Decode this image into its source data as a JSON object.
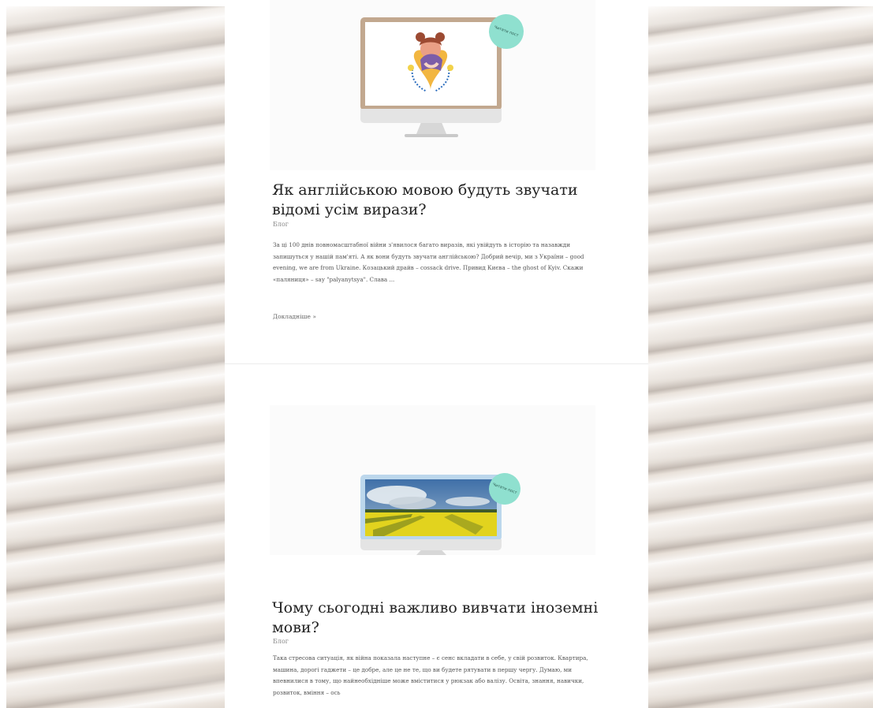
{
  "posts": [
    {
      "badge": "Читати пост",
      "title": "Як англійською мовою будуть звучати відомі усім вирази?",
      "category": "Блог",
      "excerpt": "За ці 100 днів повномасштабної війни з'явилося багато виразів, які увійдуть в історію та назавжди запишуться у нашій пам'яті. А як вони будуть звучати англійською? Добрий вечір, ми з України – good evening, we are from Ukraine. Козацький драйв – cossack drive. Привид Києва – the ghost of Kyiv. Скажи «паляниця» – say \"palyanytsya\". Слава ...",
      "read_more": "Докладніше »",
      "thumb_icon": "woman-hugging-heart-illustration"
    },
    {
      "badge": "Читати пост",
      "title": "Чому сьогодні важливо вивчати іноземні мови?",
      "category": "Блог",
      "excerpt": "Така стресова ситуація, як війна показала наступне – є сенс вкладати в себе, у свій розвиток. Квартира, машина, дорогі гаджети – це добре, але це не те, що ви будете рятувати в першу чергу. Думаю, ми впевнилися в тому, що найнеобхідніше може вміститися у рюкзак або валізу. Освіта, знання, навички, розвиток, вміння – ось",
      "thumb_icon": "sunflower-field-photo"
    }
  ],
  "colors": {
    "badge": "#8fe0cf",
    "monitor_frame_1": "#c2a88f",
    "monitor_frame_2": "#bcd7ec",
    "background_texture": "#ede6df"
  }
}
